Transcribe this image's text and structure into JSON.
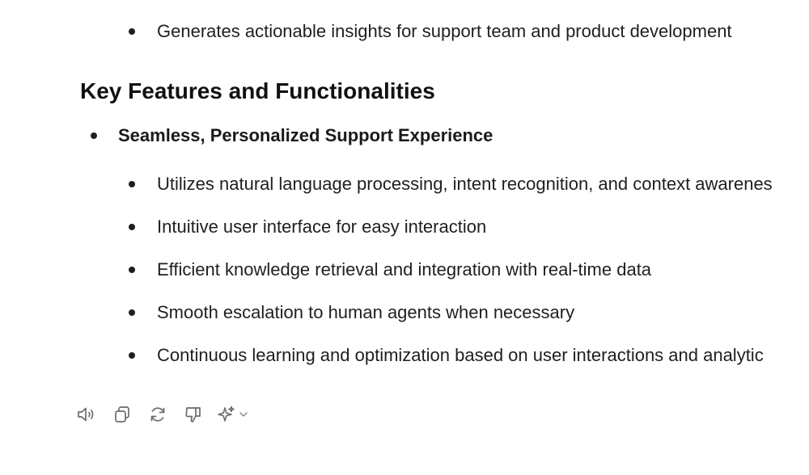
{
  "content": {
    "top_item": "Generates actionable insights for support team and product development",
    "heading": "Key Features and Functionalities",
    "section": {
      "title": "Seamless, Personalized Support Experience",
      "items": [
        "Utilizes natural language processing, intent recognition, and context awarenes",
        "Intuitive user interface for easy interaction",
        "Efficient knowledge retrieval and integration with real-time data",
        "Smooth escalation to human agents when necessary",
        "Continuous learning and optimization based on user interactions and analytic"
      ]
    }
  },
  "toolbar": {
    "icons": [
      "speaker-icon",
      "copy-icon",
      "regenerate-icon",
      "thumbs-down-icon",
      "sparkle-icon",
      "chevron-down-icon"
    ],
    "icon_color": "#6b6b6b"
  }
}
